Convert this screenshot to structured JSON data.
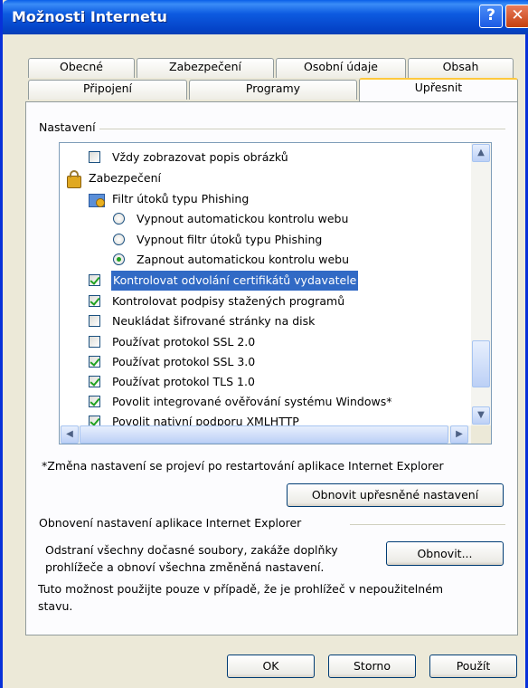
{
  "window": {
    "title": "Možnosti Internetu",
    "help_glyph": "?",
    "close_glyph": "✕"
  },
  "tabs": {
    "row_back": [
      "Obecné",
      "Zabezpečení",
      "Osobní údaje",
      "Obsah"
    ],
    "row_front": [
      "Připojení",
      "Programy",
      "Upřesnit"
    ],
    "active": "Upřesnit"
  },
  "settings": {
    "group_label": "Nastavení",
    "items": [
      {
        "kind": "checkbox",
        "checked": false,
        "label": "Vždy zobrazovat popis obrázků"
      },
      {
        "kind": "category",
        "icon": "lock-icon",
        "label": "Zabezpečení"
      },
      {
        "kind": "subcategory",
        "icon": "phishing-filter-icon",
        "label": "Filtr útoků typu Phishing"
      },
      {
        "kind": "radio",
        "checked": false,
        "label": "Vypnout automatickou kontrolu webu"
      },
      {
        "kind": "radio",
        "checked": false,
        "label": "Vypnout filtr útoků typu Phishing"
      },
      {
        "kind": "radio",
        "checked": true,
        "label": "Zapnout automatickou kontrolu webu"
      },
      {
        "kind": "checkbox",
        "checked": true,
        "selected": true,
        "label": "Kontrolovat odvolání certifikátů vydavatele"
      },
      {
        "kind": "checkbox",
        "checked": true,
        "label": "Kontrolovat podpisy stažených programů"
      },
      {
        "kind": "checkbox",
        "checked": false,
        "label": "Neukládat šifrované stránky na disk"
      },
      {
        "kind": "checkbox",
        "checked": false,
        "label": "Používat protokol SSL 2.0"
      },
      {
        "kind": "checkbox",
        "checked": true,
        "label": "Používat protokol SSL 3.0"
      },
      {
        "kind": "checkbox",
        "checked": true,
        "label": "Používat protokol TLS 1.0"
      },
      {
        "kind": "checkbox",
        "checked": true,
        "label": "Povolit integrované ověřování systému Windows*"
      },
      {
        "kind": "checkbox",
        "checked": true,
        "label": "Povolit nativní podporu XMLHTTP"
      }
    ],
    "scroll_up": "▲",
    "scroll_down": "▼",
    "scroll_left": "◀",
    "scroll_right": "▶"
  },
  "restart_note": "*Změna nastavení se projeví po restartování aplikace Internet Explorer",
  "restore_advanced_button": "Obnovit upřesněné nastavení",
  "reset": {
    "group_label": "Obnovení nastavení aplikace Internet Explorer",
    "description_line1": "Odstraní všechny dočasné soubory, zakáže doplňky",
    "description_line2": "prohlížeče a obnoví všechna změněná nastavení.",
    "button": "Obnovit...",
    "warning_line1": "Tuto možnost použijte pouze v případě, že je prohlížeč v nepoužitelném",
    "warning_line2": "stavu."
  },
  "footer": {
    "ok": "OK",
    "cancel": "Storno",
    "apply": "Použít"
  }
}
